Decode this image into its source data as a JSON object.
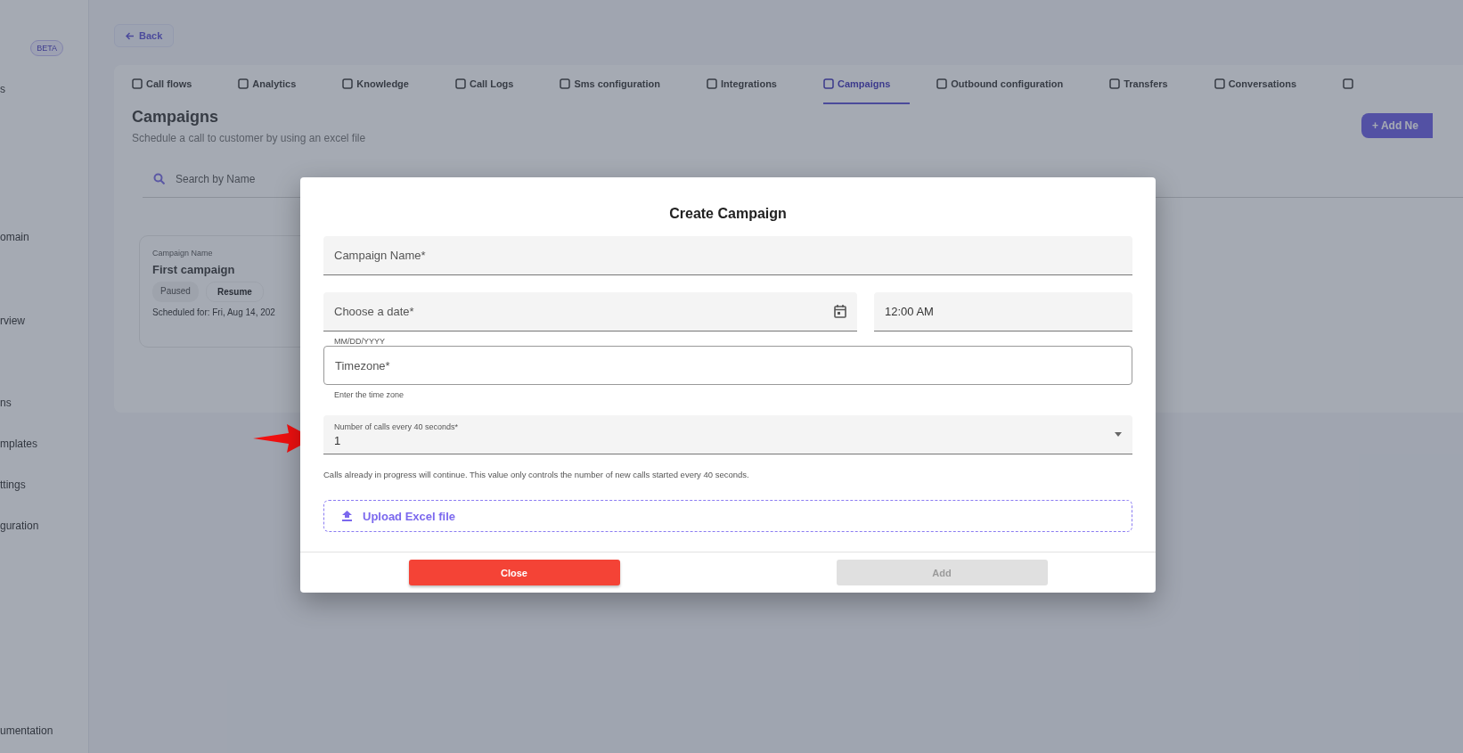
{
  "sidebar": {
    "badge": "BETA",
    "items": [
      {
        "label": "s"
      },
      {
        "label": "omain"
      },
      {
        "label": "rview"
      },
      {
        "label": "ns"
      },
      {
        "label": "mplates"
      },
      {
        "label": "ttings"
      },
      {
        "label": "guration"
      }
    ],
    "footer": "umentation"
  },
  "back_button": "Back",
  "tabs": [
    {
      "label": "Call flows",
      "selected": false
    },
    {
      "label": "Analytics",
      "selected": false
    },
    {
      "label": "Knowledge",
      "selected": false
    },
    {
      "label": "Call Logs",
      "selected": false
    },
    {
      "label": "Sms configuration",
      "selected": false
    },
    {
      "label": "Integrations",
      "selected": false
    },
    {
      "label": "Campaigns",
      "selected": true
    },
    {
      "label": "Outbound configuration",
      "selected": false
    },
    {
      "label": "Transfers",
      "selected": false
    },
    {
      "label": "Conversations",
      "selected": false
    }
  ],
  "page": {
    "title": "Campaigns",
    "subtitle": "Schedule a call to customer by using an excel file",
    "add_button": "+ Add Ne",
    "search": {
      "placeholder": "Search by Name"
    }
  },
  "campaign_card": {
    "caption": "Campaign Name",
    "name": "First campaign",
    "status": "Paused",
    "action": "Resume",
    "schedule": "Scheduled for: Fri, Aug 14, 202"
  },
  "dialog": {
    "title": "Create Campaign",
    "fields": [
      {
        "kind": "filled",
        "placeholder": "Campaign Name*"
      },
      {
        "kind": "date",
        "placeholder": "Choose a date*",
        "helper": "MM/DD/YYYY"
      },
      {
        "kind": "time",
        "value": "12:00 AM"
      },
      {
        "kind": "outlined",
        "placeholder": "Timezone*",
        "helper": "Enter the time zone"
      },
      {
        "kind": "select",
        "label": "Number of calls every 40 seconds*",
        "value": "1",
        "helper": "Calls already in progress will continue. This value only controls the number of new calls started every 40 seconds."
      }
    ],
    "upload": "Upload Excel file",
    "buttons": [
      {
        "label": "Close",
        "kind": "danger",
        "disabled": false
      },
      {
        "label": "Add",
        "kind": "primary",
        "disabled": true
      }
    ]
  }
}
